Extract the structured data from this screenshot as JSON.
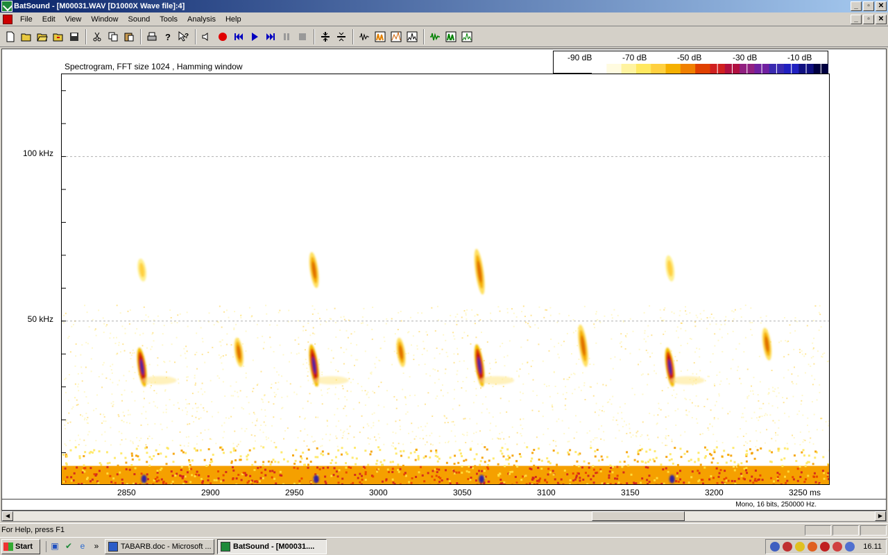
{
  "window": {
    "title": "BatSound - [M00031.WAV [D1000X Wave file]:4]"
  },
  "menu": [
    "File",
    "Edit",
    "View",
    "Window",
    "Sound",
    "Tools",
    "Analysis",
    "Help"
  ],
  "toolbar_icons": [
    "new-icon",
    "open-icon",
    "open-folder-icon",
    "open-recent-icon",
    "save-icon",
    "cut-icon",
    "copy-icon",
    "paste-icon",
    "print-icon",
    "help-icon",
    "context-help-icon",
    "speaker-icon",
    "record-icon",
    "rewind-icon",
    "play-icon",
    "fast-forward-icon",
    "pause-icon",
    "stop-icon",
    "zoom-in-icon",
    "zoom-out-icon",
    "waveform-icon",
    "spectrogram-icon",
    "power-spectrum-icon",
    "spectrum-icon",
    "wave-green-icon",
    "spectrogram-green-icon",
    "spectrum-green-icon"
  ],
  "plot": {
    "caption": "Spectrogram, FFT size 1024 , Hamming window",
    "colorbar_labels": [
      "-90 dB",
      "-70 dB",
      "-50 dB",
      "-30 dB",
      "-10 dB"
    ],
    "y_labels": [
      "100 kHz",
      "50 kHz"
    ],
    "x_labels": [
      "2850",
      "2900",
      "2950",
      "3000",
      "3050",
      "3100",
      "3150",
      "3200",
      "3250 ms"
    ]
  },
  "chart_data": {
    "type": "heatmap",
    "title": "Spectrogram, FFT size 1024 , Hamming window",
    "xlabel": "ms",
    "ylabel": "kHz",
    "xlim": [
      2810,
      3270
    ],
    "ylim": [
      0,
      125
    ],
    "x_ticks": [
      2850,
      2900,
      2950,
      3000,
      3050,
      3100,
      3150,
      3200,
      3250
    ],
    "y_ticks": [
      50,
      100
    ],
    "grid": true,
    "colorbar_db": [
      -90,
      -70,
      -50,
      -30,
      -10
    ],
    "calls": [
      {
        "t": 2858,
        "f_high": 42,
        "f_low": 30,
        "level": "strong"
      },
      {
        "t": 2858,
        "f_high": 69,
        "f_low": 62,
        "level": "weak"
      },
      {
        "t": 2916,
        "f_high": 45,
        "f_low": 36,
        "level": "medium"
      },
      {
        "t": 2961,
        "f_high": 43,
        "f_low": 30,
        "level": "strong"
      },
      {
        "t": 2961,
        "f_high": 71,
        "f_low": 60,
        "level": "medium"
      },
      {
        "t": 3013,
        "f_high": 45,
        "f_low": 36,
        "level": "medium"
      },
      {
        "t": 3060,
        "f_high": 43,
        "f_low": 30,
        "level": "strong"
      },
      {
        "t": 3060,
        "f_high": 72,
        "f_low": 58,
        "level": "medium"
      },
      {
        "t": 3122,
        "f_high": 49,
        "f_low": 36,
        "level": "medium"
      },
      {
        "t": 3174,
        "f_high": 42,
        "f_low": 30,
        "level": "strong"
      },
      {
        "t": 3174,
        "f_high": 70,
        "f_low": 62,
        "level": "weak"
      },
      {
        "t": 3232,
        "f_high": 48,
        "f_low": 38,
        "level": "medium"
      }
    ]
  },
  "info": {
    "format": "Mono, 16 bits, 250000 Hz."
  },
  "status": {
    "message": "For Help, press F1"
  },
  "taskbar": {
    "start": "Start",
    "tasks": [
      {
        "label": "TABARB.doc - Microsoft ...",
        "active": false
      },
      {
        "label": "BatSound - [M00031....",
        "active": true
      }
    ],
    "clock": "16.11"
  }
}
